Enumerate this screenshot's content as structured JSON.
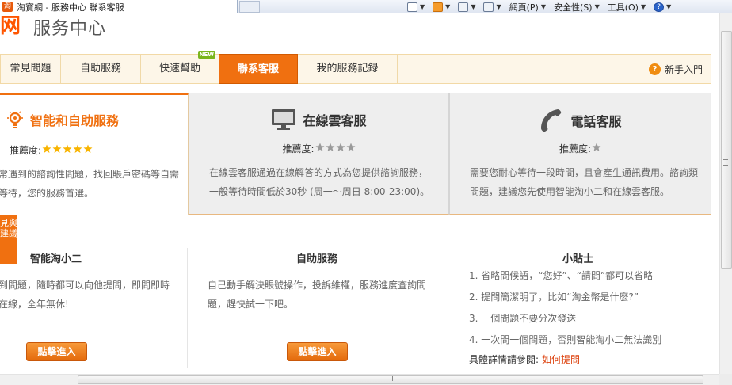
{
  "browser": {
    "tab_title": "淘寶網 - 服務中心 聯系客服",
    "toolbar": {
      "page_menu": "網頁(P)",
      "safety_menu": "安全性(S)",
      "tools_menu": "工具(O)"
    }
  },
  "brand": {
    "logo_text": "t网",
    "site_section": "服务中心"
  },
  "nav": {
    "items": [
      {
        "label": "常見問題"
      },
      {
        "label": "自助服務"
      },
      {
        "label": "快速幫助",
        "badge": "NEW"
      },
      {
        "label": "聯系客服",
        "active": true
      },
      {
        "label": "我的服務記録"
      }
    ],
    "beginner_label": "新手入門"
  },
  "service_cards": [
    {
      "title": "智能和自助服務",
      "recommend_label": "推薦度:",
      "stars": 5,
      "description": "常遇到的諮詢性問題，找回賬戶密碼等自需等待，您的服務首選。"
    },
    {
      "title": "在線雲客服",
      "recommend_label": "推薦度:",
      "stars": 4,
      "description": "在線雲客服通過在線解答的方式為您提供諮詢服務，一般等待時間低於30秒 (周一～周日 8:00-23:00)。"
    },
    {
      "title": "電話客服",
      "recommend_label": "推薦度:",
      "stars": 1,
      "description": "需要您耐心等待一段時間，且會產生通訊費用。諮詢類問題，建議您先使用智能淘小二和在線雲客服。"
    }
  ],
  "suggest_tab": "見與建議",
  "sections": {
    "bot": {
      "title": "智能淘小二",
      "description": "到問題，隨時都可以向他提問，即問即時在線，全年無休!",
      "button": "點擊進入"
    },
    "self_service": {
      "title": "自助服務",
      "description": "自己動手解決賬號操作，投訴維權，服務進度查詢問題，趕快試一下吧。",
      "button": "點擊進入"
    },
    "tips": {
      "title": "小貼士",
      "items": [
        "1. 省略問候語，“您好”、“請問”都可以省略",
        "2. 提問簡潔明了，比如“淘金幣是什麼?”",
        "3. 一個問題不要分次發送",
        "4. 一次問一個問題，否則智能淘小二無法識別"
      ],
      "footer_text": "具體詳情請參閲:",
      "footer_link": "如何提問"
    }
  },
  "colors": {
    "accent": "#f07010",
    "nav_bg": "#fdf6e8",
    "card_inactive_bg": "#eeeeee",
    "star_active": "#f8b400",
    "star_inactive": "#9a9a9a"
  }
}
